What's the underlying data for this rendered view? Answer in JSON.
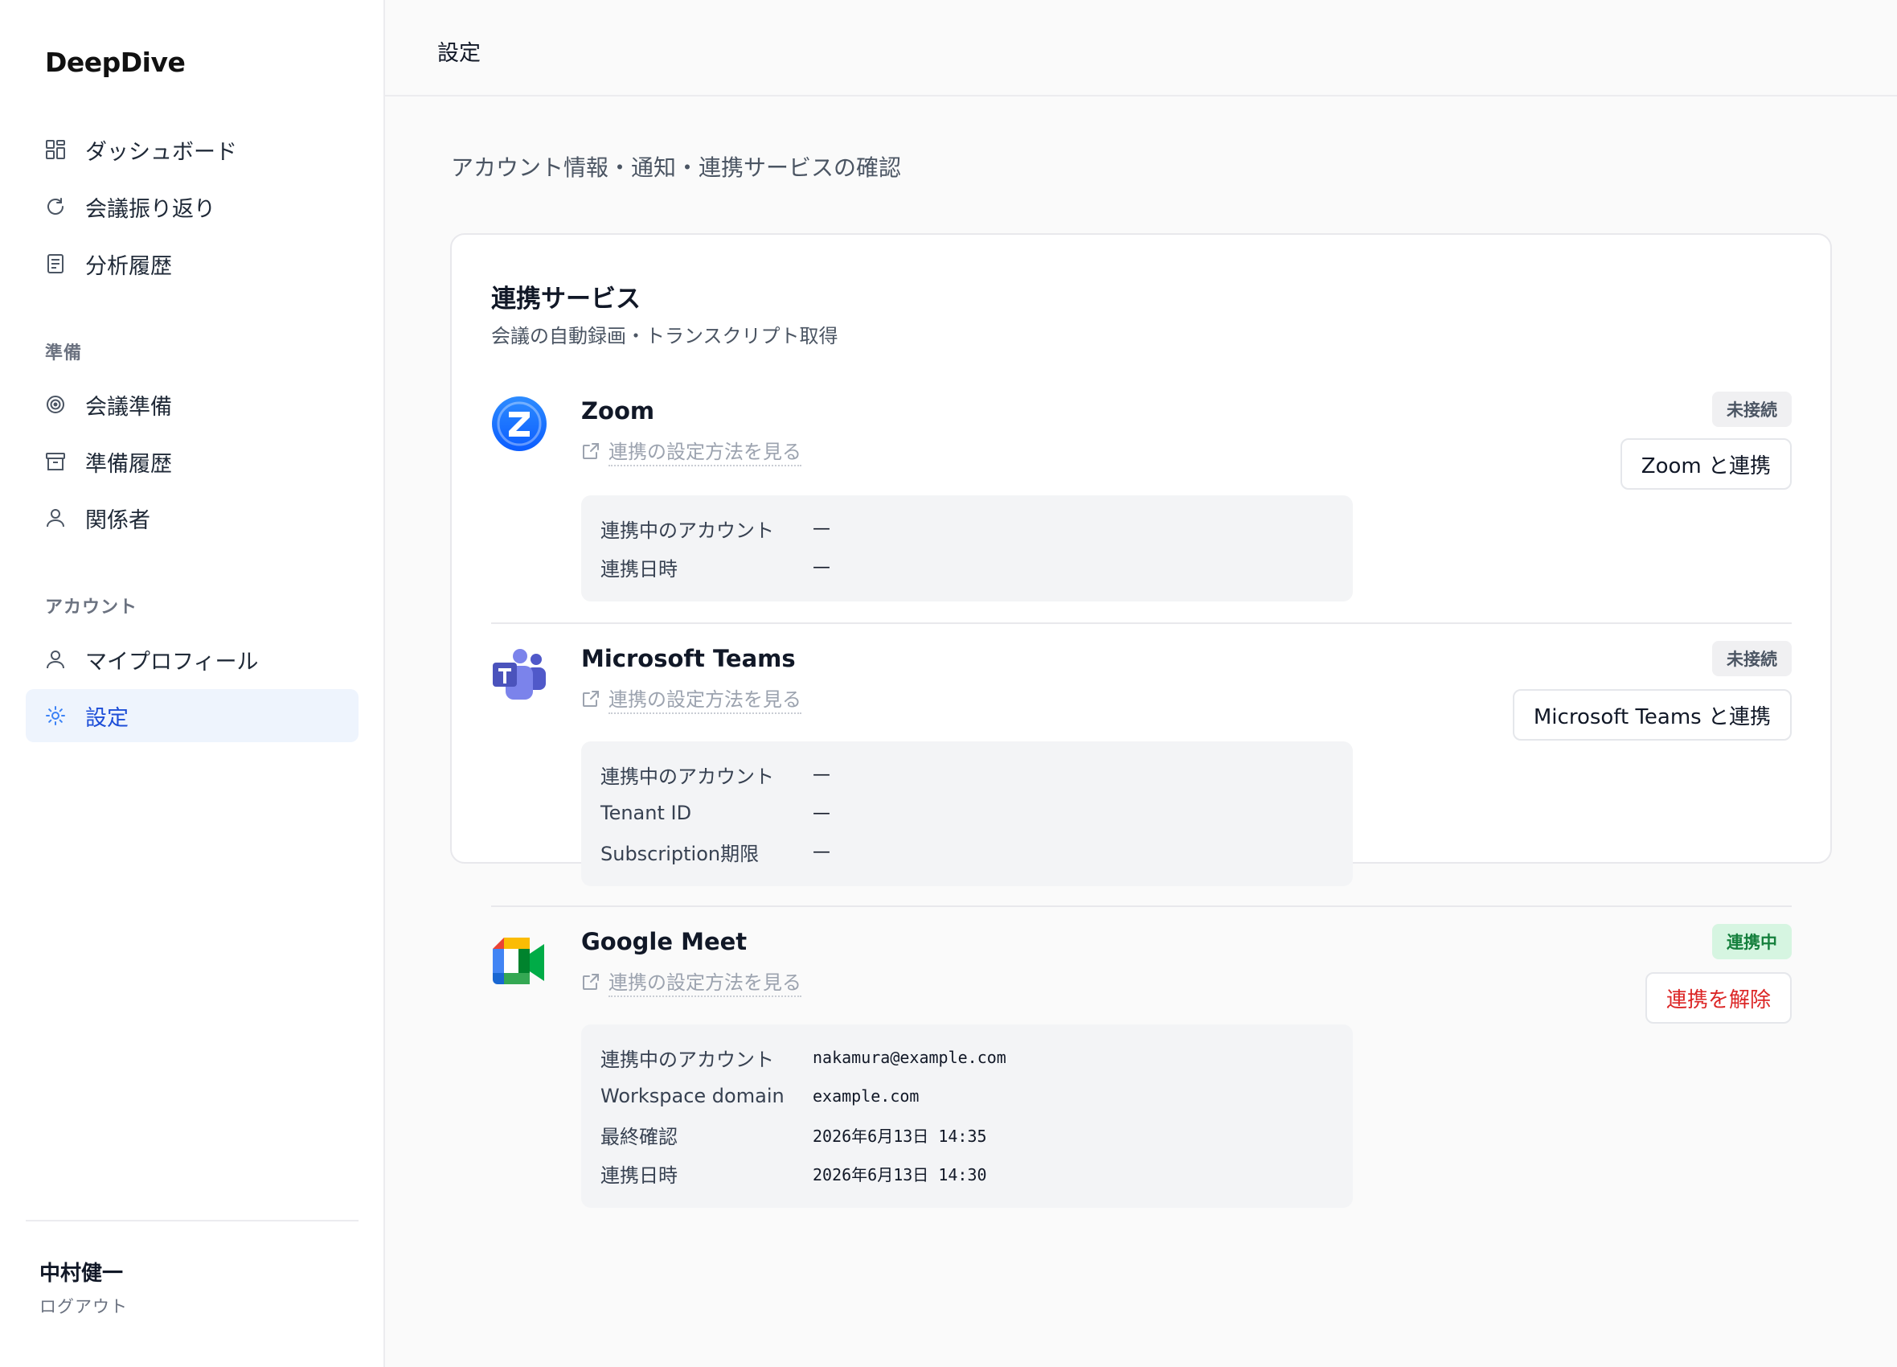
{
  "app": {
    "brand": "DeepDive"
  },
  "sidebar": {
    "primary": [
      {
        "label": "ダッシュボード",
        "icon": "dashboard-grid-icon"
      },
      {
        "label": "会議振り返り",
        "icon": "refresh-icon"
      },
      {
        "label": "分析履歴",
        "icon": "document-icon"
      }
    ],
    "sections": {
      "prep": "準備",
      "account": "アカウント"
    },
    "prep_items": [
      {
        "label": "会議準備",
        "icon": "target-icon"
      },
      {
        "label": "準備履歴",
        "icon": "archive-box-icon"
      },
      {
        "label": "関係者",
        "icon": "person-icon"
      }
    ],
    "account_items": [
      {
        "label": "マイプロフィール",
        "icon": "person-icon"
      },
      {
        "label": "設定",
        "icon": "sun-gear-icon",
        "active": true
      }
    ],
    "user": {
      "name": "中村健一",
      "logout": "ログアウト"
    }
  },
  "header": {
    "title": "設定"
  },
  "page": {
    "subtitle": "アカウント情報・通知・連携サービスの確認"
  },
  "integrations": {
    "title": "連携サービス",
    "description": "会議の自動録画・トランスクリプト取得",
    "link_label": "連携の設定方法を見る",
    "services": [
      {
        "name": "Zoom",
        "status": "未接続",
        "action": "Zoom と連携",
        "rows": [
          {
            "key": "連携中のアカウント",
            "value": "—"
          },
          {
            "key": "連携日時",
            "value": "—"
          }
        ]
      },
      {
        "name": "Microsoft Teams",
        "status": "未接続",
        "action": "Microsoft Teams と連携",
        "rows": [
          {
            "key": "連携中のアカウント",
            "value": "—"
          },
          {
            "key": "Tenant ID",
            "value": "—"
          },
          {
            "key": "Subscription期限",
            "value": "—"
          }
        ]
      },
      {
        "name": "Google Meet",
        "status": "連携中",
        "action": "連携を解除",
        "rows": [
          {
            "key": "連携中のアカウント",
            "value": "nakamura@example.com"
          },
          {
            "key": "Workspace domain",
            "value": "example.com"
          },
          {
            "key": "最終確認",
            "value": "2026年6月13日 14:35"
          },
          {
            "key": "連携日時",
            "value": "2026年6月13日 14:30"
          }
        ]
      }
    ]
  },
  "colors": {
    "accent": "#1d4ed8",
    "active_bg": "#eef4fd",
    "connected_bg": "#d6f5e1",
    "connected_text": "#15803d",
    "danger": "#dc2626"
  }
}
